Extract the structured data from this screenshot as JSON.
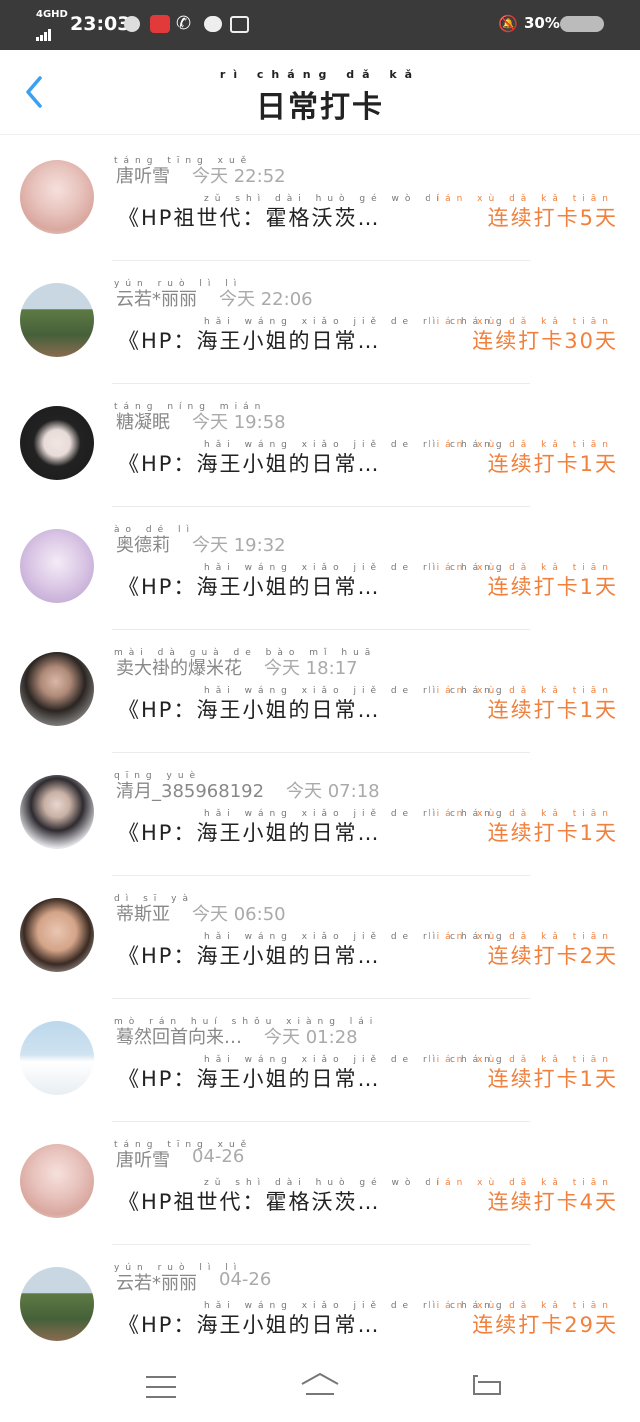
{
  "status_bar": {
    "network": "4GHD",
    "time": "23:03",
    "battery": "30%"
  },
  "header": {
    "title_pinyin": "rì cháng dǎ kǎ",
    "title": "日常打卡",
    "back_icon": "chevron-left-icon"
  },
  "checkins": [
    {
      "user": "唐听雪",
      "user_pinyin": "táng tīng xuě",
      "time": "今天 22:52",
      "book": "《HP祖世代：霍格沃茨…",
      "book_pinyin": "zǔ shì dài   huò gé wò cí",
      "streak": "连续打卡5天",
      "streak_pinyin": "lián xù dǎ kǎ tiān",
      "avatar": "anime-girl-pink"
    },
    {
      "user": "云若*丽丽",
      "user_pinyin": "yún ruò lì lì",
      "time": "今天 22:06",
      "book": "《HP：海王小姐的日常…",
      "book_pinyin": "hǎi wáng xiǎo jiě de rì cháng",
      "streak": "连续打卡30天",
      "streak_pinyin": "lián xù dǎ kǎ tiān",
      "avatar": "landscape-hill"
    },
    {
      "user": "糖凝眠",
      "user_pinyin": "táng níng mián",
      "time": "今天 19:58",
      "book": "《HP：海王小姐的日常…",
      "book_pinyin": "hǎi wáng xiǎo jiě de rì cháng",
      "streak": "连续打卡1天",
      "streak_pinyin": "lián xù dǎ kǎ tiān",
      "avatar": "dark-hair-girl"
    },
    {
      "user": "奥德莉",
      "user_pinyin": "ào dé lì",
      "time": "今天 19:32",
      "book": "《HP：海王小姐的日常…",
      "book_pinyin": "hǎi wáng xiǎo jiě de rì cháng",
      "streak": "连续打卡1天",
      "streak_pinyin": "lián xù dǎ kǎ tiān",
      "avatar": "anime-lavender"
    },
    {
      "user": "卖大褂的爆米花",
      "user_pinyin": "mài dà guà de bào mǐ huā",
      "time": "今天 18:17",
      "book": "《HP：海王小姐的日常…",
      "book_pinyin": "hǎi wáng xiǎo jiě de rì cháng",
      "streak": "连续打卡1天",
      "streak_pinyin": "lián xù dǎ kǎ tiān",
      "avatar": "woman-portrait"
    },
    {
      "user": "清月_385968192",
      "user_pinyin": "qīng yuè",
      "time": "今天 07:18",
      "book": "《HP：海王小姐的日常…",
      "book_pinyin": "hǎi wáng xiǎo jiě de rì cháng",
      "streak": "连续打卡1天",
      "streak_pinyin": "lián xù dǎ kǎ tiān",
      "avatar": "woman-white"
    },
    {
      "user": "蒂斯亚",
      "user_pinyin": "dì sī yà",
      "time": "今天 06:50",
      "book": "《HP：海王小姐的日常…",
      "book_pinyin": "hǎi wáng xiǎo jiě de rì cháng",
      "streak": "连续打卡2天",
      "streak_pinyin": "lián xù dǎ kǎ tiān",
      "avatar": "woman-face"
    },
    {
      "user": "蓦然回首向来…",
      "user_pinyin": "mò rán huí shǒu xiàng lái",
      "time": "今天 01:28",
      "book": "《HP：海王小姐的日常…",
      "book_pinyin": "hǎi wáng xiǎo jiě de rì cháng",
      "streak": "连续打卡1天",
      "streak_pinyin": "lián xù dǎ kǎ tiān",
      "avatar": "penguin"
    },
    {
      "user": "唐听雪",
      "user_pinyin": "táng tīng xuě",
      "time": "04-26",
      "book": "《HP祖世代：霍格沃茨…",
      "book_pinyin": "zǔ shì dài   huò gé wò cí",
      "streak": "连续打卡4天",
      "streak_pinyin": "lián xù dǎ kǎ tiān",
      "avatar": "anime-girl-pink"
    },
    {
      "user": "云若*丽丽",
      "user_pinyin": "yún ruò lì lì",
      "time": "04-26",
      "book": "《HP：海王小姐的日常…",
      "book_pinyin": "hǎi wáng xiǎo jiě de rì cháng",
      "streak": "连续打卡29天",
      "streak_pinyin": "lián xù dǎ kǎ tiān",
      "avatar": "landscape-hill"
    }
  ],
  "nav_bar": {
    "menu_icon": "menu-icon",
    "home_icon": "home-icon",
    "back_icon": "back-icon"
  }
}
